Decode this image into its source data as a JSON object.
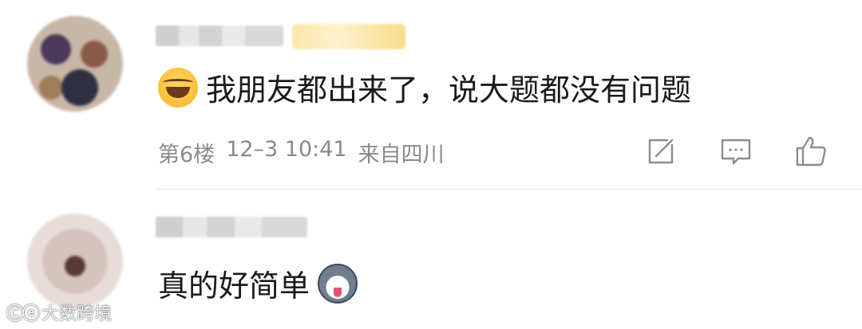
{
  "comments": [
    {
      "text": "我朋友都出来了，说大题都没有问题",
      "emoji": "grinning-tears-emoji",
      "meta": {
        "floor": "第6楼",
        "time": "12–3 10:41",
        "location": "来自四川"
      },
      "actions": [
        "share-icon",
        "reply-icon",
        "like-icon"
      ]
    },
    {
      "text": "真的好简单",
      "emoji": "husky-emoji"
    }
  ],
  "watermark": {
    "logo": "Ⓒⓔ",
    "text": "大数跨境"
  }
}
